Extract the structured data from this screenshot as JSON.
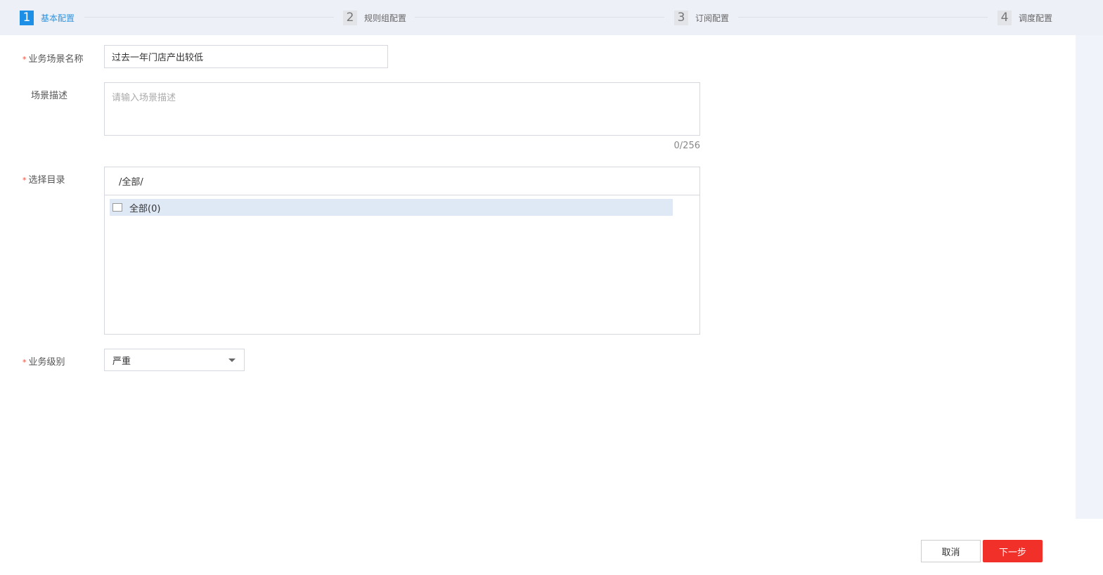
{
  "steps": [
    {
      "num": "1",
      "label": "基本配置"
    },
    {
      "num": "2",
      "label": "规则组配置"
    },
    {
      "num": "3",
      "label": "订阅配置"
    },
    {
      "num": "4",
      "label": "调度配置"
    }
  ],
  "form": {
    "required_mark": "*",
    "name_label": "业务场景名称",
    "name_value": "过去一年门店产出较低",
    "desc_label": "场景描述",
    "desc_placeholder": "请输入场景描述",
    "desc_counter": "0/256",
    "dir_label": "选择目录",
    "dir_path": "/全部/",
    "dir_item": "全部(0)",
    "level_label": "业务级别",
    "level_value": "严重"
  },
  "footer": {
    "cancel": "取消",
    "next": "下一步"
  }
}
